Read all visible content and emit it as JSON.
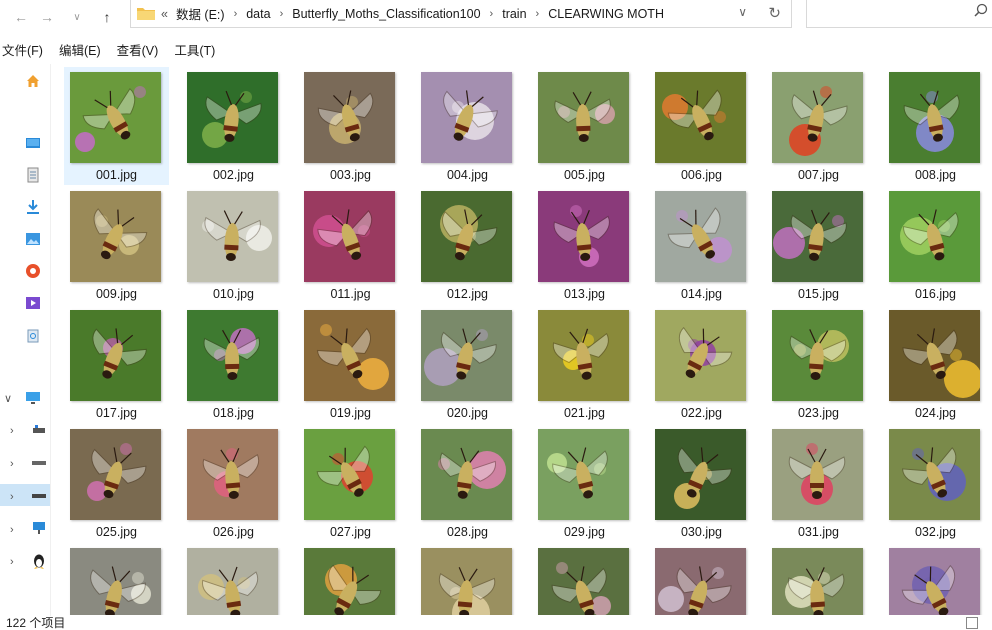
{
  "address": {
    "overflow": "«",
    "crumbs": [
      "数据 (E:)",
      "data",
      "Butterfly_Moths_Classification100",
      "train",
      "CLEARWING MOTH"
    ]
  },
  "search": {
    "placeholder": ""
  },
  "menu": [
    "文件(F)",
    "编辑(E)",
    "查看(V)",
    "工具(T)"
  ],
  "files": [
    {
      "name": "001.jpg",
      "bg": "#6a9a3c",
      "accent": "#c46bc8"
    },
    {
      "name": "002.jpg",
      "bg": "#2f6e2a",
      "accent": "#7fb04a"
    },
    {
      "name": "003.jpg",
      "bg": "#7a6a58",
      "accent": "#c8b070"
    },
    {
      "name": "004.jpg",
      "bg": "#a48fb0",
      "accent": "#e8e0e8"
    },
    {
      "name": "005.jpg",
      "bg": "#6e8a4a",
      "accent": "#d4a0a8"
    },
    {
      "name": "006.jpg",
      "bg": "#6a7a2c",
      "accent": "#e07a30"
    },
    {
      "name": "007.jpg",
      "bg": "#8aa070",
      "accent": "#e04020"
    },
    {
      "name": "008.jpg",
      "bg": "#4a7e30",
      "accent": "#8a8ae0"
    },
    {
      "name": "009.jpg",
      "bg": "#9a8a58",
      "accent": "#d0c080"
    },
    {
      "name": "010.jpg",
      "bg": "#c0c0b0",
      "accent": "#f0f0ea"
    },
    {
      "name": "011.jpg",
      "bg": "#9a3a60",
      "accent": "#d05090"
    },
    {
      "name": "012.jpg",
      "bg": "#4a6a30",
      "accent": "#b8b060"
    },
    {
      "name": "013.jpg",
      "bg": "#8a3a7a",
      "accent": "#d070c0"
    },
    {
      "name": "014.jpg",
      "bg": "#a0a8a0",
      "accent": "#c090d0"
    },
    {
      "name": "015.jpg",
      "bg": "#4a6a3a",
      "accent": "#c070c0"
    },
    {
      "name": "016.jpg",
      "bg": "#5a9a3a",
      "accent": "#a0d060"
    },
    {
      "name": "017.jpg",
      "bg": "#4a7a2a",
      "accent": "#b060a0"
    },
    {
      "name": "018.jpg",
      "bg": "#3e7a30",
      "accent": "#c070c0"
    },
    {
      "name": "019.jpg",
      "bg": "#8a6a3a",
      "accent": "#f0b040"
    },
    {
      "name": "020.jpg",
      "bg": "#7a8a6a",
      "accent": "#b0a0c0"
    },
    {
      "name": "021.jpg",
      "bg": "#8a8a3a",
      "accent": "#f0d020"
    },
    {
      "name": "022.jpg",
      "bg": "#a0a860",
      "accent": "#9040a0"
    },
    {
      "name": "023.jpg",
      "bg": "#5a8a3a",
      "accent": "#c0c060"
    },
    {
      "name": "024.jpg",
      "bg": "#6a5a2a",
      "accent": "#f0c030"
    },
    {
      "name": "025.jpg",
      "bg": "#7a6a50",
      "accent": "#d070b0"
    },
    {
      "name": "026.jpg",
      "bg": "#a07a60",
      "accent": "#e06080"
    },
    {
      "name": "027.jpg",
      "bg": "#6aa040",
      "accent": "#e04030"
    },
    {
      "name": "028.jpg",
      "bg": "#6a8a50",
      "accent": "#e080b0"
    },
    {
      "name": "029.jpg",
      "bg": "#7aa060",
      "accent": "#c0e090"
    },
    {
      "name": "030.jpg",
      "bg": "#3a5a2a",
      "accent": "#e0c060"
    },
    {
      "name": "031.jpg",
      "bg": "#9aa080",
      "accent": "#e04060"
    },
    {
      "name": "032.jpg",
      "bg": "#7a8a4a",
      "accent": "#6060c0"
    },
    {
      "name": "",
      "bg": "#8a8a80",
      "accent": "#e0e0d0"
    },
    {
      "name": "",
      "bg": "#b0b0a0",
      "accent": "#d0c080"
    },
    {
      "name": "",
      "bg": "#5a7a3a",
      "accent": "#e0a040"
    },
    {
      "name": "",
      "bg": "#9a9060",
      "accent": "#e0d0a0"
    },
    {
      "name": "",
      "bg": "#5a7040",
      "accent": "#d0a0b0"
    },
    {
      "name": "",
      "bg": "#8a6a70",
      "accent": "#d0c0d0"
    },
    {
      "name": "",
      "bg": "#7a8a5a",
      "accent": "#e0e0c0"
    },
    {
      "name": "",
      "bg": "#a080a0",
      "accent": "#7060b0"
    }
  ],
  "status": {
    "count": "122 个项目"
  }
}
